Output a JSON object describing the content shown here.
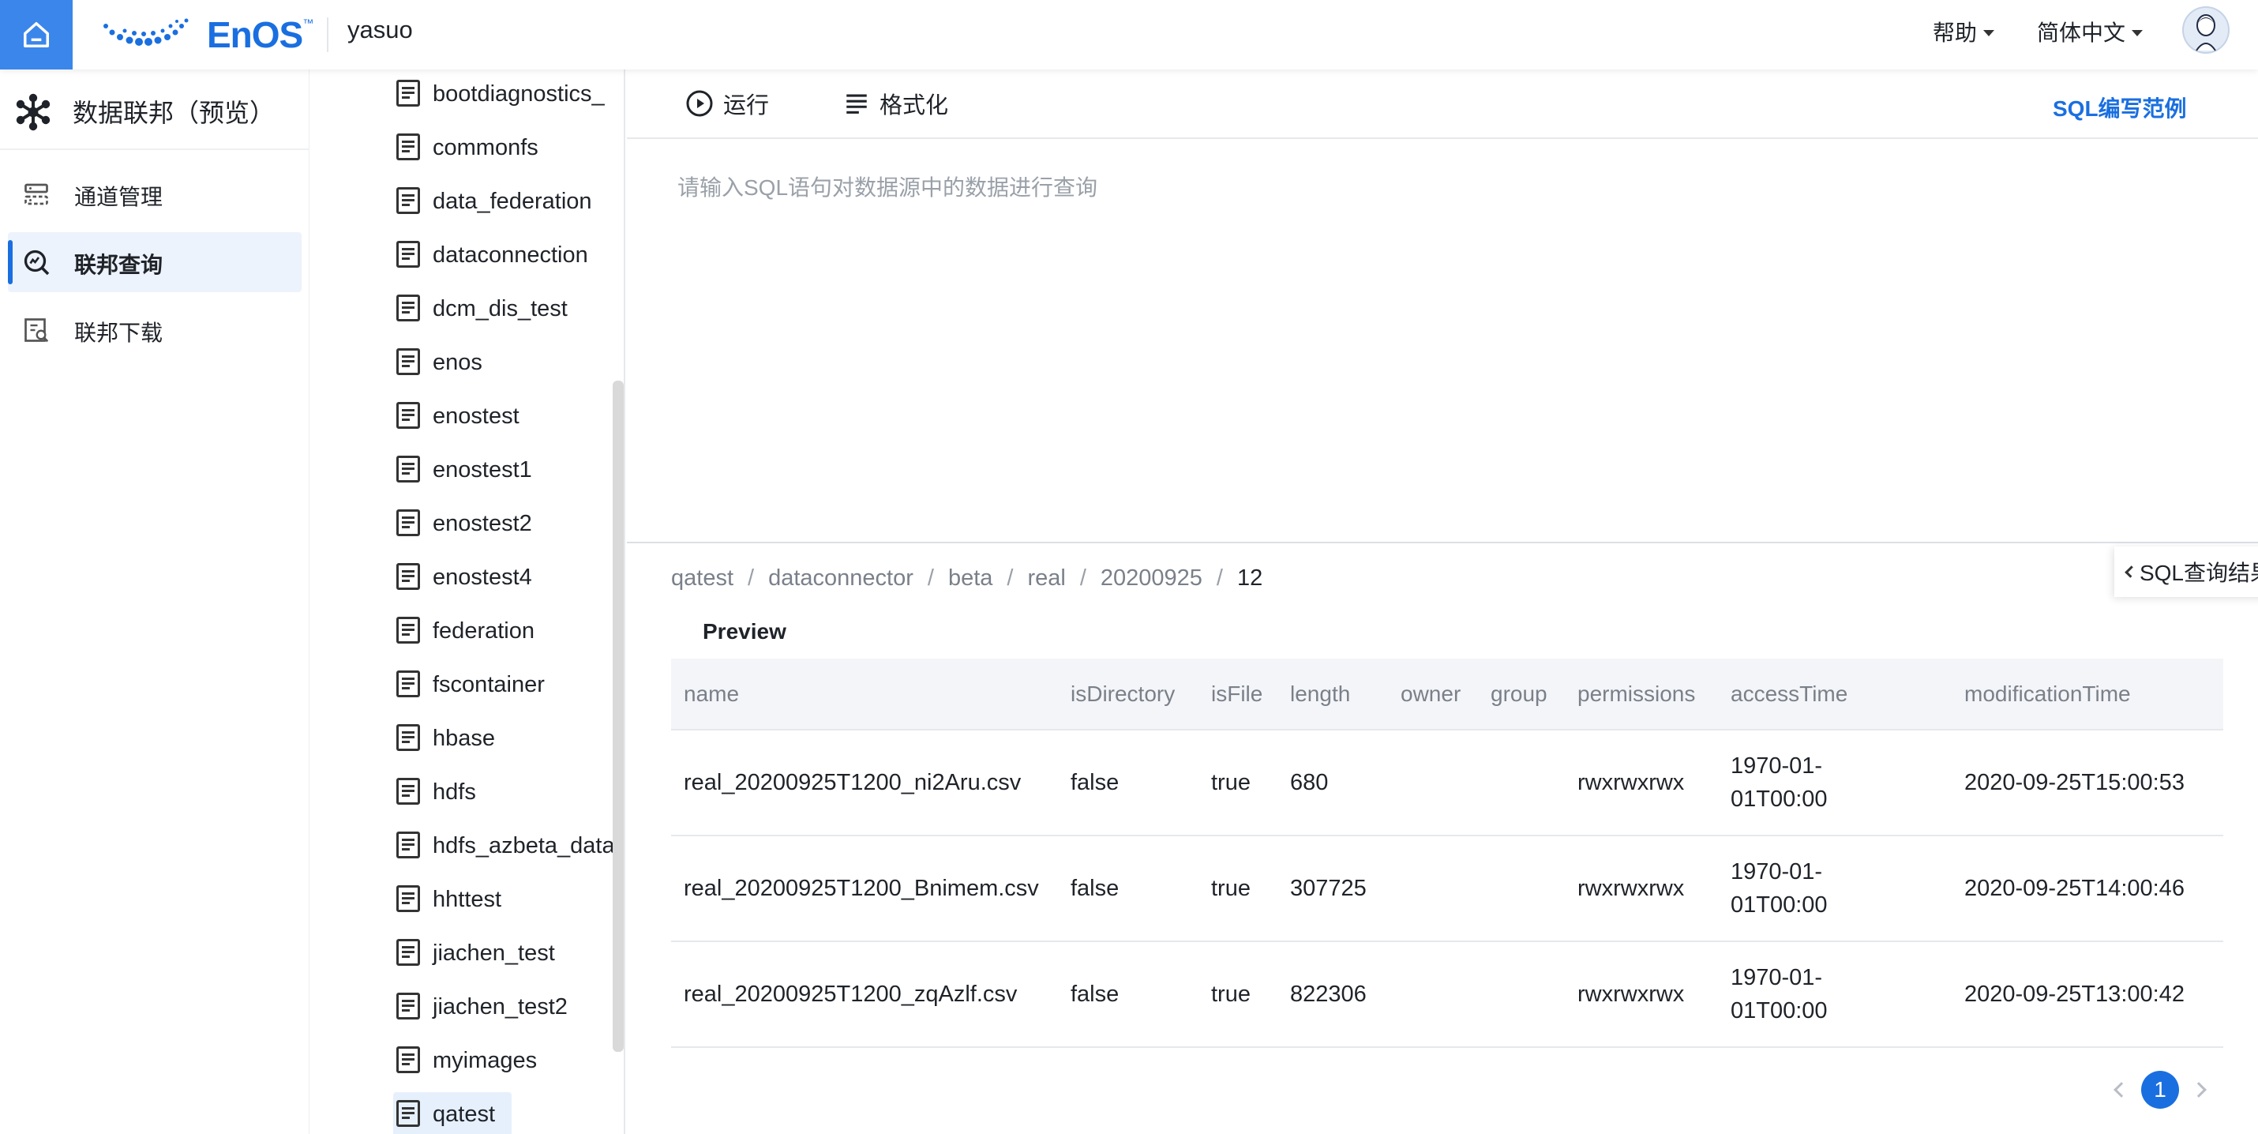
{
  "header": {
    "logo_text": "EnOS",
    "logo_tm": "™",
    "workspace": "yasuo",
    "help_label": "帮助",
    "language_label": "简体中文"
  },
  "nav": {
    "title": "数据联邦（预览）",
    "items": [
      {
        "label": "通道管理",
        "icon": "channel-icon"
      },
      {
        "label": "联邦查询",
        "icon": "query-icon",
        "active": true
      },
      {
        "label": "联邦下载",
        "icon": "download-icon"
      }
    ]
  },
  "tree": {
    "items": [
      "bootdiagnostics_",
      "commonfs",
      "data_federation",
      "dataconnection",
      "dcm_dis_test",
      "enos",
      "enostest",
      "enostest1",
      "enostest2",
      "enostest4",
      "federation",
      "fscontainer",
      "hbase",
      "hdfs",
      "hdfs_azbeta_data",
      "hhttest",
      "jiachen_test",
      "jiachen_test2",
      "myimages",
      "qatest"
    ],
    "selected": "qatest"
  },
  "editor": {
    "run_label": "运行",
    "format_label": "格式化",
    "sql_example_label": "SQL编写范例",
    "placeholder": "请输入SQL语句对数据源中的数据进行查询"
  },
  "breadcrumb": [
    "qatest",
    "dataconnector",
    "beta",
    "real",
    "20200925",
    "12"
  ],
  "result_tab_label": "SQL查询结果",
  "preview_label": "Preview",
  "table": {
    "columns": [
      "name",
      "isDirectory",
      "isFile",
      "length",
      "owner",
      "group",
      "permissions",
      "accessTime",
      "modificationTime"
    ],
    "rows": [
      [
        "real_20200925T1200_ni2Aru.csv",
        "false",
        "true",
        "680",
        "",
        "",
        "rwxrwxrwx",
        "1970-01-01T00:00",
        "2020-09-25T15:00:53"
      ],
      [
        "real_20200925T1200_Bnimem.csv",
        "false",
        "true",
        "307725",
        "",
        "",
        "rwxrwxrwx",
        "1970-01-01T00:00",
        "2020-09-25T14:00:46"
      ],
      [
        "real_20200925T1200_zqAzlf.csv",
        "false",
        "true",
        "822306",
        "",
        "",
        "rwxrwxrwx",
        "1970-01-01T00:00",
        "2020-09-25T13:00:42"
      ]
    ]
  },
  "pagination": {
    "current": "1"
  },
  "colors": {
    "accent": "#1a6fe0",
    "home_bg": "#3b86ea"
  }
}
